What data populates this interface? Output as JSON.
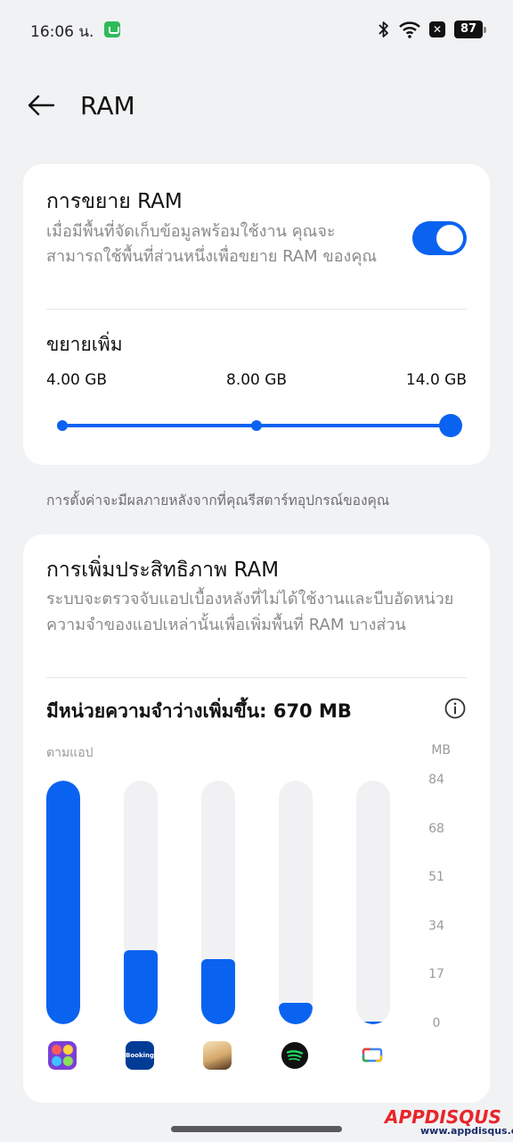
{
  "status_bar": {
    "time": "16:06 น.",
    "battery": "87"
  },
  "header": {
    "title": "RAM"
  },
  "ram_expansion": {
    "title": "การขยาย RAM",
    "description": "เมื่อมีพื้นที่จัดเก็บข้อมูลพร้อมใช้งาน คุณจะสามารถใช้พื้นที่ส่วนหนึ่งเพื่อขยาย RAM ของคุณ",
    "toggle_on": true,
    "extend_label": "ขยายเพิ่ม",
    "sizes": [
      "4.00 GB",
      "8.00 GB",
      "14.0 GB"
    ],
    "selected_index": 2
  },
  "note": "การตั้งค่าจะมีผลภายหลังจากที่คุณรีสตาร์ทอุปกรณ์ของคุณ",
  "ram_optimization": {
    "title": "การเพิ่มประสิทธิภาพ RAM",
    "description": "ระบบจะตรวจจับแอปเบื้องหลังที่ไม่ได้ใช้งานและบีบอัดหน่วยความจำของแอปเหล่านั้นเพื่อเพิ่มพื้นที่ RAM บางส่วน",
    "freed_memory": "มีหน่วยความจำว่างเพิ่มขึ้น: 670 MB"
  },
  "chart_data": {
    "type": "bar",
    "xlabel": "ตามแอป",
    "ylabel": "MB",
    "ylim": [
      0,
      84
    ],
    "yticks": [
      "84",
      "68",
      "51",
      "34",
      "17",
      "0"
    ],
    "categories": [
      "bubble-game-app",
      "booking-app",
      "anime-game-app",
      "spotify-app",
      "google-tv-app"
    ],
    "values": [
      84,
      25.5,
      22.5,
      7.5,
      1
    ],
    "colors": {
      "fill": "#0a63f0",
      "track": "#f1f1f3"
    }
  },
  "watermark": {
    "logo": "APPDISQUS",
    "url": "www.appdisqus.com"
  }
}
